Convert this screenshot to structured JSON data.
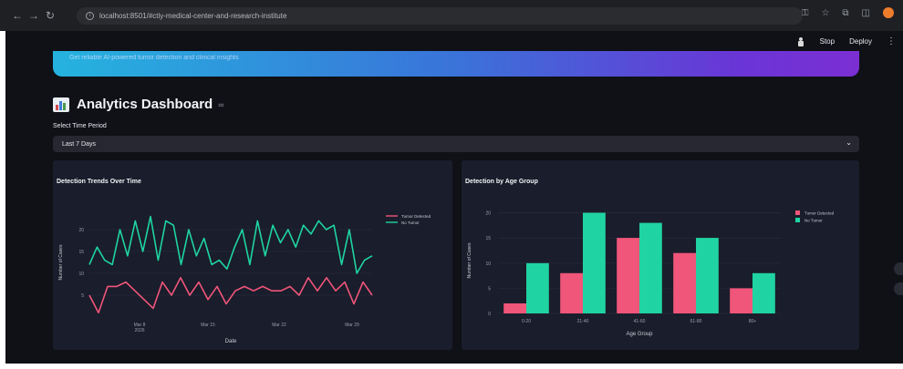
{
  "browser": {
    "url": "localhost:8501/#ctiy-medical-center-and-research-institute",
    "back_glyph": "←",
    "forward_glyph": "→",
    "reload_glyph": "↻",
    "info_glyph": "i",
    "icons": [
      "key-icon",
      "star-icon",
      "extensions-icon",
      "sidebar-icon",
      "profile-icon"
    ]
  },
  "topbar": {
    "stop_label": "Stop",
    "deploy_label": "Deploy",
    "menu_glyph": "⋮"
  },
  "banner": {
    "text": "Get reliable AI-powered tumor detection and clinical insights",
    "gradient_colors": [
      "#25b3df",
      "#3a73d9",
      "#6a35d6",
      "#7b2fd3"
    ]
  },
  "dashboard": {
    "title": "Analytics Dashboard",
    "link_glyph": "∞",
    "select_label": "Select Time Period",
    "select_value": "Last 7 Days",
    "select_caret": "⌄"
  },
  "colors": {
    "tumor": "#f0557a",
    "no_tumor": "#1fd4a2",
    "axis_text": "#9aa0ab",
    "grid": "#2a2e3d"
  },
  "chart_data": [
    {
      "type": "line",
      "title": "Detection Trends Over Time",
      "xlabel": "Date",
      "ylabel": "Number of Cases",
      "x_ticks": [
        "Mar 8\n2026",
        "Mar 15",
        "Mar 22",
        "Mar 29"
      ],
      "y_ticks": [
        5,
        10,
        15,
        20
      ],
      "ylim": [
        0,
        25
      ],
      "legend_position": "top-right",
      "series": [
        {
          "name": "Tumor Detected",
          "color": "#f0557a",
          "values": [
            5,
            1,
            7,
            7,
            8,
            6,
            4,
            2,
            8,
            5,
            9,
            5,
            8,
            4,
            7,
            3,
            6,
            7,
            6,
            7,
            6,
            6,
            7,
            5,
            9,
            6,
            9,
            6,
            8,
            3,
            8,
            5
          ]
        },
        {
          "name": "No Tumor",
          "color": "#1fd4a2",
          "values": [
            12,
            16,
            13,
            12,
            20,
            14,
            22,
            15,
            23,
            13,
            22,
            21,
            12,
            20,
            14,
            18,
            12,
            13,
            11,
            16,
            20,
            12,
            22,
            14,
            21,
            17,
            20,
            16,
            21,
            19,
            22,
            20,
            21,
            12,
            20,
            10,
            13,
            14
          ]
        }
      ]
    },
    {
      "type": "bar",
      "title": "Detection by Age Group",
      "xlabel": "Age Group",
      "ylabel": "Number of Cases",
      "categories": [
        "0-20",
        "21-40",
        "41-60",
        "61-80",
        "80+"
      ],
      "y_ticks": [
        0,
        5,
        10,
        15,
        20
      ],
      "ylim": [
        0,
        21
      ],
      "legend_position": "top-right",
      "series": [
        {
          "name": "Tumor Detected",
          "color": "#f0557a",
          "values": [
            2,
            8,
            15,
            12,
            5
          ]
        },
        {
          "name": "No Tumor",
          "color": "#1fd4a2",
          "values": [
            10,
            20,
            18,
            15,
            8
          ]
        }
      ]
    }
  ]
}
